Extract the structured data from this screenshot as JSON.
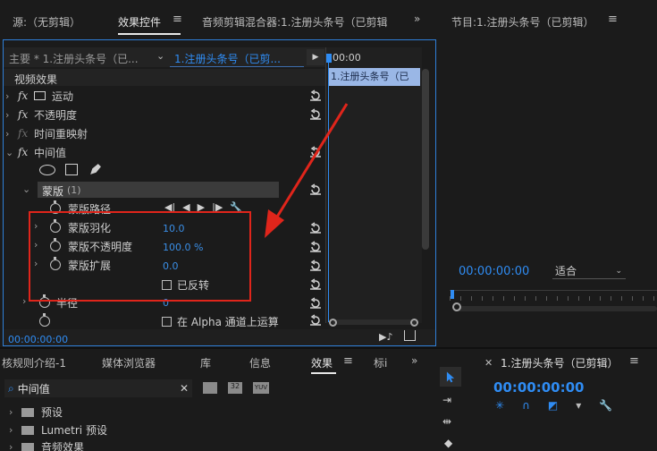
{
  "top_tabs": {
    "source": "源:（无剪辑）",
    "effect_controls": "效果控件",
    "audio_mixer": "音频剪辑混合器:1.注册头条号（已剪辑",
    "program": "节目:1.注册头条号（已剪辑）"
  },
  "effect_controls": {
    "master_clip": "主要 * 1.注册头条号（已...",
    "clip_selector": "1.注册头条号（已剪...",
    "timeline_time": "00:00",
    "timeline_clip": "1.注册头条号（已",
    "section_header": "视频效果",
    "effects": [
      "运动",
      "不透明度",
      "时间重映射",
      "中间值"
    ],
    "mask_label": "蒙版",
    "mask_count": "(1)",
    "mask_path": "蒙版路径",
    "feather_label": "蒙版羽化",
    "feather_value": "10.0",
    "opacity_label": "蒙版不透明度",
    "opacity_value": "100.0 %",
    "expansion_label": "蒙版扩展",
    "expansion_value": "0.0",
    "inverted_label": "已反转",
    "radius_label": "半径",
    "radius_value": "0",
    "alpha_label": "在 Alpha 通道上运算",
    "timecode": "00:00:00:00"
  },
  "program": {
    "timecode": "00:00:00:00",
    "zoom": "适合"
  },
  "bottom_tabs": [
    "核规则介绍-1",
    "媒体浏览器",
    "库",
    "信息",
    "效果",
    "标i"
  ],
  "effects_panel": {
    "search_value": "中间值",
    "folders": [
      "预设",
      "Lumetri 预设",
      "音频效果"
    ]
  },
  "timeline": {
    "title": "1.注册头条号（已剪辑）",
    "timecode": "00:00:00:00"
  },
  "colors": {
    "accent": "#2f8cf3",
    "highlight": "#e0251b",
    "clip": "#9ab7e6"
  }
}
